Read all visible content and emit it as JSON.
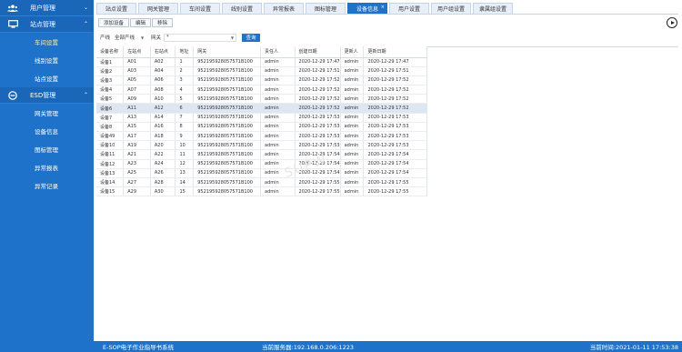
{
  "sidebar": {
    "groups": [
      {
        "label": "用户管理",
        "icon": "users-icon",
        "expanded": false
      },
      {
        "label": "站点管理",
        "icon": "monitor-icon",
        "expanded": true
      },
      {
        "label": "ESD管理",
        "icon": "esd-icon",
        "expanded": true
      }
    ],
    "site_items": [
      "车间设置",
      "线别设置",
      "站点设置"
    ],
    "esd_items": [
      "网关管理",
      "设备信息",
      "图标管理",
      "异常报表",
      "异常记录"
    ]
  },
  "tabs": [
    "站点设置",
    "网关管理",
    "车间设置",
    "线别设置",
    "异常报表",
    "图标管理",
    "设备信息",
    "用户设置",
    "用户组设置",
    "隶属组设置"
  ],
  "active_tab": "设备信息",
  "toolbar": {
    "add": "添加设备",
    "edit": "编辑",
    "delete": "移除"
  },
  "filter": {
    "line_label": "产线",
    "line_value": "全部产线",
    "gateway_label": "网关",
    "gateway_value": "*",
    "query": "查询"
  },
  "table": {
    "columns": [
      "设备名称",
      "左站点",
      "右站点",
      "地址",
      "网关",
      "责任人",
      "创建日期",
      "更新人",
      "更新日期"
    ],
    "rows": [
      [
        "设备1",
        "A01",
        "A02",
        "1",
        "952195928057571B100",
        "admin",
        "2020-12-29 17:47",
        "admin",
        "2020-12-29 17:47"
      ],
      [
        "设备2",
        "A03",
        "A04",
        "2",
        "952195928057571B100",
        "admin",
        "2020-12-29 17:51",
        "admin",
        "2020-12-29 17:51"
      ],
      [
        "设备3",
        "A05",
        "A06",
        "3",
        "952195928057571B100",
        "admin",
        "2020-12-29 17:52",
        "admin",
        "2020-12-29 17:52"
      ],
      [
        "设备4",
        "A07",
        "A08",
        "4",
        "952195928057571B100",
        "admin",
        "2020-12-29 17:52",
        "admin",
        "2020-12-29 17:52"
      ],
      [
        "设备5",
        "A09",
        "A10",
        "5",
        "952195928057571B100",
        "admin",
        "2020-12-29 17:52",
        "admin",
        "2020-12-29 17:52"
      ],
      [
        "设备6",
        "A11",
        "A12",
        "6",
        "952195928057571B100",
        "admin",
        "2020-12-29 17:52",
        "admin",
        "2020-12-29 17:52"
      ],
      [
        "设备7",
        "A13",
        "A14",
        "7",
        "952195928057571B100",
        "admin",
        "2020-12-29 17:53",
        "admin",
        "2020-12-29 17:53"
      ],
      [
        "设备8",
        "A15",
        "A16",
        "8",
        "952195928057571B100",
        "admin",
        "2020-12-29 17:53",
        "admin",
        "2020-12-29 17:53"
      ],
      [
        "设备49",
        "A17",
        "A18",
        "9",
        "952195928057571B100",
        "admin",
        "2020-12-29 17:53",
        "admin",
        "2020-12-29 17:53"
      ],
      [
        "设备10",
        "A19",
        "A20",
        "10",
        "952195928057571B100",
        "admin",
        "2020-12-29 17:53",
        "admin",
        "2020-12-29 17:53"
      ],
      [
        "设备11",
        "A21",
        "A22",
        "11",
        "952195928057571B100",
        "admin",
        "2020-12-29 17:54",
        "admin",
        "2020-12-29 17:54"
      ],
      [
        "设备12",
        "A23",
        "A24",
        "12",
        "952195928057571B100",
        "admin",
        "2020-12-29 17:54",
        "admin",
        "2020-12-29 17:54"
      ],
      [
        "设备13",
        "A25",
        "A26",
        "13",
        "952195928057571B100",
        "admin",
        "2020-12-29 17:54",
        "admin",
        "2020-12-29 17:54"
      ],
      [
        "设备14",
        "A27",
        "A28",
        "14",
        "952195928057571B100",
        "admin",
        "2020-12-29 17:55",
        "admin",
        "2020-12-29 17:55"
      ],
      [
        "设备15",
        "A29",
        "A30",
        "15",
        "952195928057571B100",
        "admin",
        "2020-12-29 17:55",
        "admin",
        "2020-12-29 17:55"
      ]
    ],
    "highlighted_row": 5
  },
  "watermark": "SUPW",
  "status": {
    "system": "E-SOP电子作业指导书系统",
    "server": "当前服务器:192.168.0.206:1223",
    "time": "当前时间:2021-01-11 17:53:38"
  }
}
